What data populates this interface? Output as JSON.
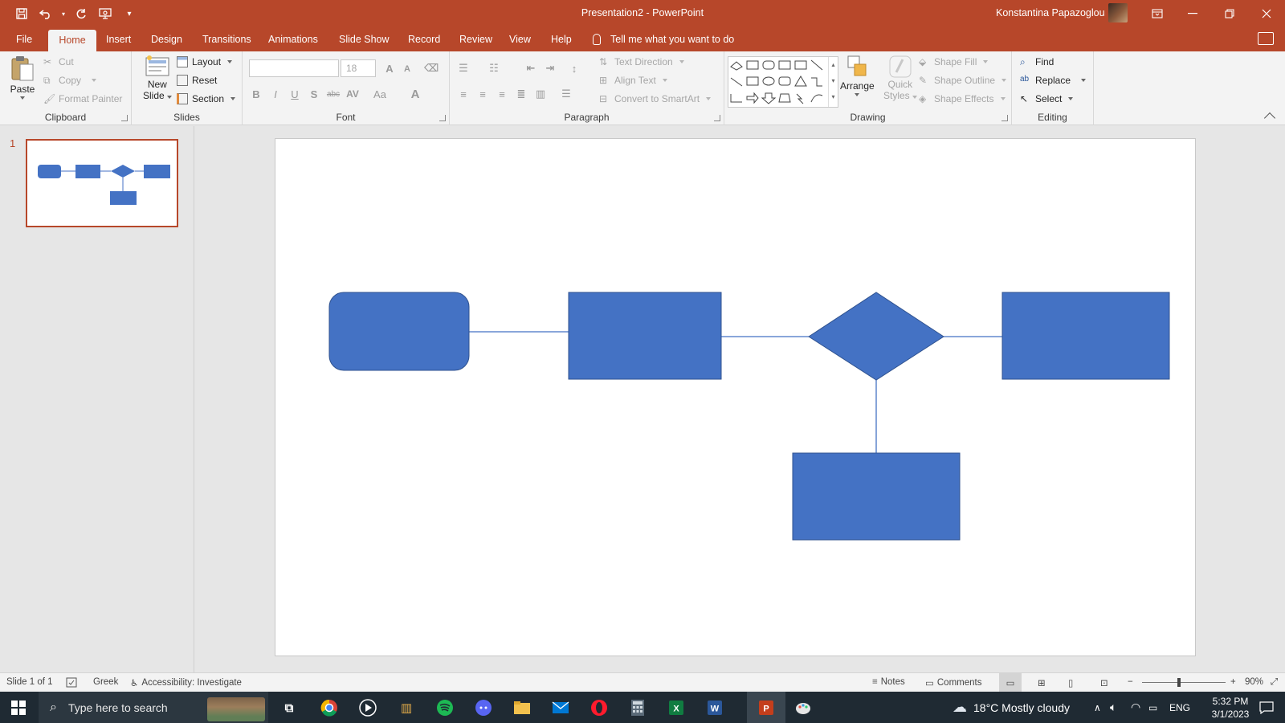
{
  "titlebar": {
    "title": "Presentation2  -  PowerPoint",
    "user_name": "Konstantina Papazoglou"
  },
  "tabs": [
    {
      "label": "File"
    },
    {
      "label": "Home"
    },
    {
      "label": "Insert"
    },
    {
      "label": "Design"
    },
    {
      "label": "Transitions"
    },
    {
      "label": "Animations"
    },
    {
      "label": "Slide Show"
    },
    {
      "label": "Record"
    },
    {
      "label": "Review"
    },
    {
      "label": "View"
    },
    {
      "label": "Help"
    }
  ],
  "tellme": "Tell me what you want to do",
  "ribbon": {
    "clipboard": {
      "label": "Clipboard",
      "paste": "Paste",
      "cut": "Cut",
      "copy": "Copy",
      "format_painter": "Format Painter"
    },
    "slides": {
      "label": "Slides",
      "new_slide_1": "New",
      "new_slide_2": "Slide",
      "layout": "Layout",
      "reset": "Reset",
      "section": "Section"
    },
    "font": {
      "label": "Font",
      "font_name": "",
      "font_size": "18"
    },
    "paragraph": {
      "label": "Paragraph",
      "text_direction": "Text Direction",
      "align_text": "Align Text",
      "convert_smartart": "Convert to SmartArt"
    },
    "drawing": {
      "label": "Drawing",
      "arrange": "Arrange",
      "quick_styles_1": "Quick",
      "quick_styles_2": "Styles",
      "shape_fill": "Shape Fill",
      "shape_outline": "Shape Outline",
      "shape_effects": "Shape Effects"
    },
    "editing": {
      "label": "Editing",
      "find": "Find",
      "replace": "Replace",
      "select": "Select"
    }
  },
  "thumbnails": {
    "slide_number": "1"
  },
  "statusbar": {
    "slide_info": "Slide 1 of 1",
    "language": "Greek",
    "accessibility": "Accessibility: Investigate",
    "notes": "Notes",
    "comments": "Comments",
    "zoom_minus": "−",
    "zoom_plus": "+",
    "zoom": "90%"
  },
  "taskbar": {
    "search_placeholder": "Type here to search",
    "weather": "18°C  Mostly cloudy",
    "language": "ENG",
    "time": "5:32 PM",
    "date": "3/1/2023"
  },
  "colors": {
    "accent": "#b7472a",
    "shape_fill": "#4472c4",
    "shape_stroke": "#2f528f"
  },
  "icons": {
    "save": "save-icon",
    "undo": "undo-icon",
    "redo": "redo-icon",
    "presenter": "present-icon",
    "customize": "chevron-down-icon",
    "restore": "ribbon-display-icon"
  }
}
